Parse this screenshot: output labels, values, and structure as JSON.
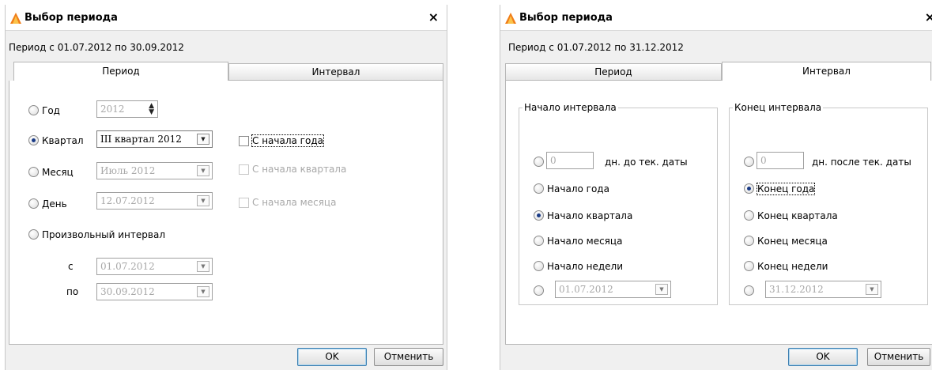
{
  "left": {
    "title": "Выбор периода",
    "close": "×",
    "period_text": "Период с 01.07.2012 по 30.09.2012",
    "tabs": [
      "Период",
      "Интервал"
    ],
    "rows": {
      "year": {
        "label": "Год",
        "value": "2012"
      },
      "quarter": {
        "label": "Квартал",
        "value": "III квартал 2012",
        "check": "С начала года"
      },
      "month": {
        "label": "Месяц",
        "value": "Июль 2012",
        "check": "С начала квартала"
      },
      "day": {
        "label": "День",
        "value": "12.07.2012",
        "check": "С начала месяца"
      },
      "custom": {
        "label": "Произвольный интервал"
      },
      "from": {
        "label": "с",
        "value": "01.07.2012"
      },
      "to": {
        "label": "по",
        "value": "30.09.2012"
      }
    },
    "ok": "OK",
    "cancel": "Отменить"
  },
  "right": {
    "title": "Выбор периода",
    "close": "×",
    "period_text": "Период с 01.07.2012 по 31.12.2012",
    "tabs": [
      "Период",
      "Интервал"
    ],
    "start_group": {
      "title": "Начало интервала",
      "days_value": "0",
      "days_label": "дн. до тек. даты",
      "options": [
        "Начало года",
        "Начало квартала",
        "Начало месяца",
        "Начало недели"
      ],
      "date": "01.07.2012"
    },
    "end_group": {
      "title": "Конец интервала",
      "days_value": "0",
      "days_label": "дн. после тек. даты",
      "options": [
        "Конец года",
        "Конец квартала",
        "Конец месяца",
        "Конец недели"
      ],
      "date": "31.12.2012"
    },
    "ok": "OK",
    "cancel": "Отменить"
  },
  "colors": {
    "accent": "#1a3b86",
    "icon": "#f07d18"
  },
  "icons": {
    "app": "app-icon",
    "close": "close-icon",
    "dropdown": "chevron-down-icon"
  }
}
